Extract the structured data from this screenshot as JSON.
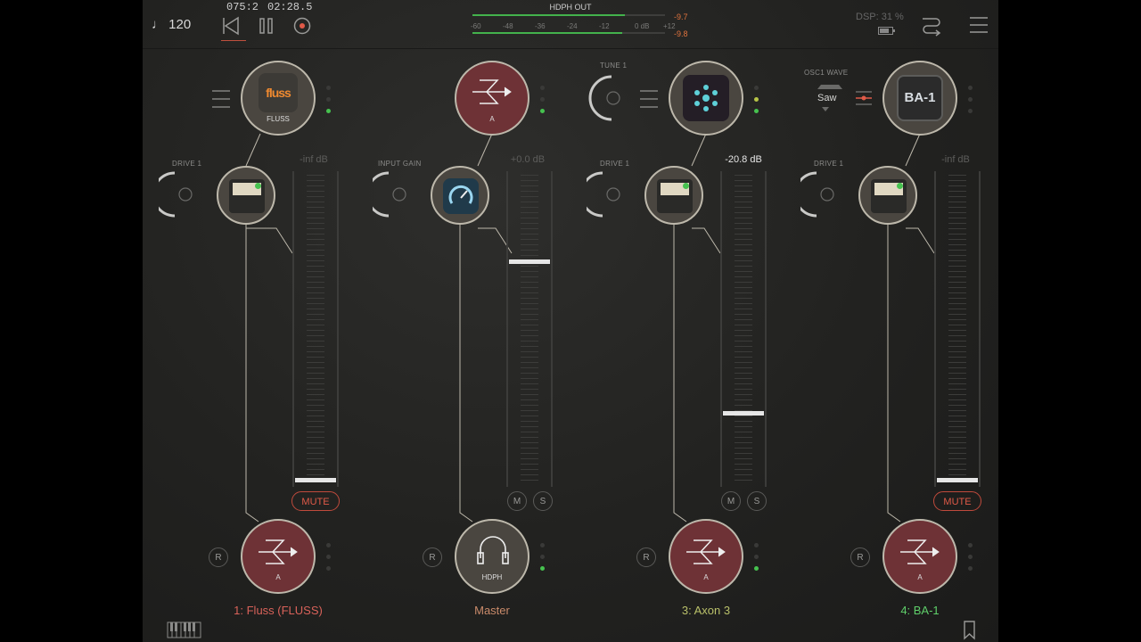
{
  "transport": {
    "tempo": "♩ 120",
    "position": "075:2",
    "time": "02:28.5"
  },
  "output_meter": {
    "title": "HDPH OUT",
    "scale": [
      "-60",
      "-48",
      "-36",
      "-24",
      "-12",
      "0 dB",
      "+12"
    ],
    "peak_l": "-9.7",
    "peak_r": "-9.8",
    "level_l": 0.79,
    "level_r": 0.78
  },
  "dsp": "DSP: 31 %",
  "colors": {
    "accent_red": "#e05a48",
    "green_led": "#46c24f",
    "ch1_name": "#d9625a",
    "master_name": "#c98a6a",
    "ch3_name": "#b9c06a",
    "ch4_name": "#5fcf6a"
  },
  "channels": [
    {
      "name": "1: Fluss (FLUSS)",
      "plugin_label": "FLUSS",
      "plugin_tile": "fluss",
      "knob_label": "DRIVE 1",
      "db": "-inf dB",
      "button": "MUTE",
      "record": "R",
      "output_label": "A",
      "fader_level": 0.0,
      "output_icon": "sum-arrow-icon"
    },
    {
      "name": "Master",
      "plugin_label": "A",
      "knob_label": "INPUT GAIN",
      "db": "+0.0 dB",
      "mute": "M",
      "solo": "S",
      "record": "R",
      "output_label": "HDPH",
      "fader_level": 0.72,
      "output_icon": "headphones-icon"
    },
    {
      "name": "3: Axon 3",
      "plugin_label": "",
      "plugin_tile": "axon",
      "knob_label": "DRIVE 1",
      "top_knob_label": "TUNE 1",
      "db": "-20.8 dB",
      "mute": "M",
      "solo": "S",
      "record": "R",
      "output_label": "A",
      "fader_level": 0.22,
      "output_icon": "sum-arrow-icon"
    },
    {
      "name": "4: BA-1",
      "plugin_label": "",
      "plugin_tile": "BA-1",
      "knob_label": "DRIVE 1",
      "top_param_label": "OSC1 WAVE",
      "top_param_value": "Saw",
      "db": "-inf dB",
      "button": "MUTE",
      "record": "R",
      "output_label": "A",
      "fader_level": 0.0,
      "output_icon": "sum-arrow-icon"
    }
  ]
}
